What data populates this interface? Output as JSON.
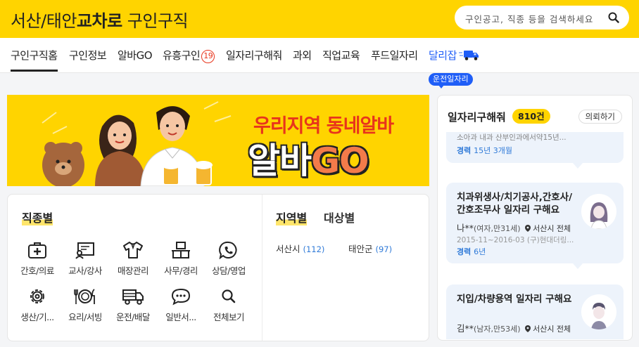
{
  "header": {
    "logo_region": "서산/태안",
    "logo_brand": "교차로",
    "logo_section": "구인구직",
    "search_placeholder": "구인공고, 직종 등을 검색하세요"
  },
  "nav": {
    "items": [
      {
        "label": "구인구직홈"
      },
      {
        "label": "구인정보"
      },
      {
        "label": "알바GO"
      },
      {
        "label": "유흥구인"
      },
      {
        "label": "일자리구해줘"
      },
      {
        "label": "과외"
      },
      {
        "label": "직업교육"
      },
      {
        "label": "푸드일자리"
      },
      {
        "label": "달리잡"
      }
    ],
    "adult_badge": "19",
    "driver_tag": "운전일자리",
    "accent_color": "#1f5ef7"
  },
  "banner": {
    "line1": "우리지역 동네알바",
    "line2_a": "알바",
    "line2_b": "GO"
  },
  "categories": {
    "title": "직종별",
    "items": [
      {
        "label": "간호/의료",
        "icon": "medical-kit-icon"
      },
      {
        "label": "교사/강사",
        "icon": "teacher-board-icon"
      },
      {
        "label": "매장관리",
        "icon": "shirt-icon"
      },
      {
        "label": "사무/경리",
        "icon": "office-desk-icon"
      },
      {
        "label": "상담/영업",
        "icon": "phone-chat-icon"
      },
      {
        "label": "생산/기...",
        "icon": "gear-icon"
      },
      {
        "label": "요리/서빙",
        "icon": "plate-cutlery-icon"
      },
      {
        "label": "운전/배달",
        "icon": "truck-icon"
      },
      {
        "label": "일반서...",
        "icon": "speech-bubble-icon"
      },
      {
        "label": "전체보기",
        "icon": "search-icon"
      }
    ]
  },
  "regions": {
    "tab_region": "지역별",
    "tab_target": "대상별",
    "items": [
      {
        "name": "서산시",
        "count": "(112)"
      },
      {
        "name": "태안군",
        "count": "(97)"
      }
    ]
  },
  "job_requests": {
    "title": "일자리구해줘",
    "count": "810건",
    "request_button": "의뢰하기",
    "cards": [
      {
        "title": "",
        "history": "소아과 내과 산부인과에서약15년...",
        "exp_label": "경력",
        "exp_value": "15년 3개월"
      },
      {
        "title_line1": "치과위생사/치기공사,간호사/",
        "title_line2": "간호조무사 일자리 구해요",
        "name": "나**",
        "info": "(여자,만31세)",
        "location": "서산시 전체",
        "history": "2015-11~2016-03 (구)현대더링...",
        "exp_label": "경력",
        "exp_value": "6년"
      },
      {
        "title_line1": "지입/차량용역 일자리 구해요",
        "name": "김**",
        "info": "(남자,만53세)",
        "location": "서산시 전체"
      }
    ]
  },
  "colors": {
    "brand_yellow": "#ffd400",
    "alert_red": "#e8341c",
    "link_blue": "#2f7ad8"
  }
}
